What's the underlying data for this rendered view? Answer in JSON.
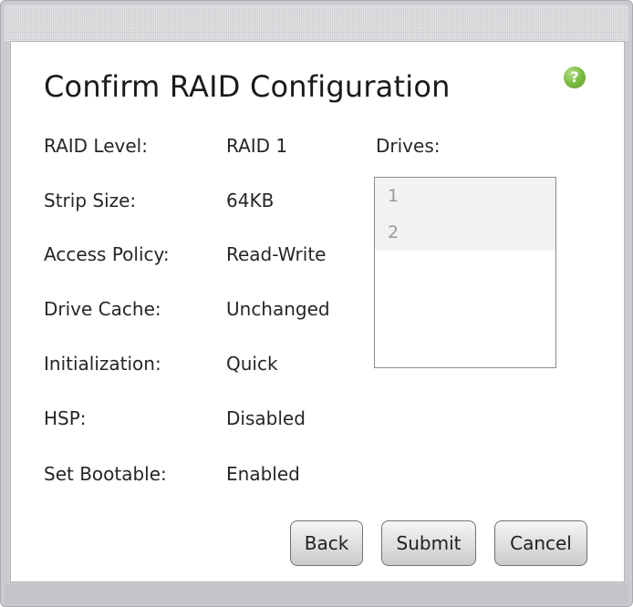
{
  "dialog": {
    "title": "Confirm RAID Configuration",
    "help_symbol": "?"
  },
  "fields": [
    {
      "label": "RAID Level:",
      "value": "RAID 1"
    },
    {
      "label": "Strip Size:",
      "value": "64KB"
    },
    {
      "label": "Access Policy:",
      "value": "Read-Write"
    },
    {
      "label": "Drive Cache:",
      "value": "Unchanged"
    },
    {
      "label": "Initialization:",
      "value": "Quick"
    },
    {
      "label": "HSP:",
      "value": "Disabled"
    },
    {
      "label": "Set Bootable:",
      "value": "Enabled"
    }
  ],
  "drives": {
    "label": "Drives:",
    "items": [
      "1",
      "2"
    ]
  },
  "buttons": {
    "back": "Back",
    "submit": "Submit",
    "cancel": "Cancel"
  }
}
